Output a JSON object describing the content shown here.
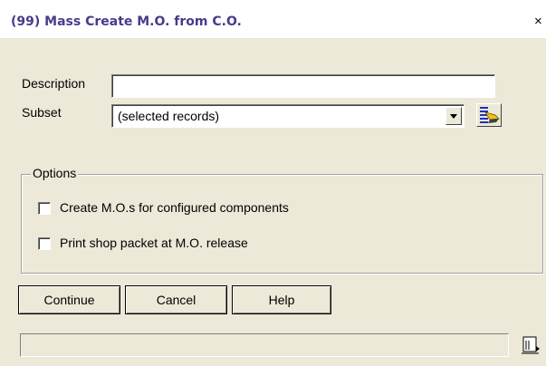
{
  "window": {
    "title": "(99) Mass Create M.O. from C.O.",
    "close_glyph": "×"
  },
  "form": {
    "description_label": "Description",
    "description_value": "",
    "subset_label": "Subset",
    "subset_value": "(selected records)"
  },
  "options": {
    "group_label": "Options",
    "items": [
      {
        "label": "Create M.O.s for configured components",
        "checked": false
      },
      {
        "label": "Print shop packet at M.O. release",
        "checked": false
      }
    ]
  },
  "buttons": {
    "continue": "Continue",
    "cancel": "Cancel",
    "help": "Help"
  },
  "status": {
    "text": ""
  },
  "icons": {
    "subset_picker": "query-wand-icon",
    "status": "document-status-icon"
  },
  "colors": {
    "title_text": "#4a3a8c",
    "background": "#ece9d8"
  }
}
